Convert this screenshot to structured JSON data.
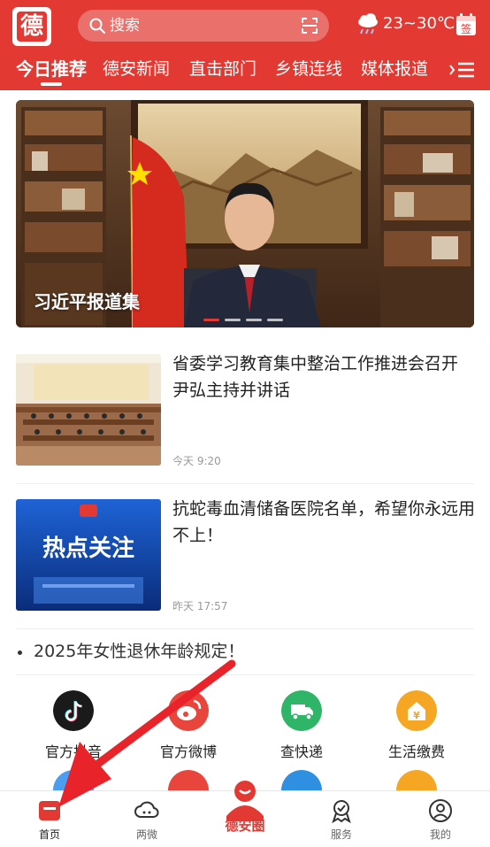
{
  "header": {
    "logo_text": "德",
    "search_placeholder": "搜索",
    "weather": "23~30℃",
    "sign_label": "签"
  },
  "tabs": [
    "今日推荐",
    "德安新闻",
    "直击部门",
    "乡镇连线",
    "媒体报道"
  ],
  "banner": {
    "caption": "习近平报道集"
  },
  "news": [
    {
      "title": "省委学习教育集中整治工作推进会召开 尹弘主持并讲话",
      "time": "今天 9:20"
    },
    {
      "title": "抗蛇毒血清储备医院名单，希望你永远用不上！",
      "time": "昨天 17:57",
      "thumb_text": "热点关注"
    }
  ],
  "ticker": "2025年女性退休年龄规定！",
  "services": [
    {
      "label": "官方抖音",
      "icon": "tiktok-icon",
      "color": "#1a1a1a"
    },
    {
      "label": "官方微博",
      "icon": "weibo-icon",
      "color": "#e8453c"
    },
    {
      "label": "查快递",
      "icon": "delivery-icon",
      "color": "#2fb567"
    },
    {
      "label": "生活缴费",
      "icon": "payment-icon",
      "color": "#f5a623"
    }
  ],
  "bottom_nav": [
    {
      "label": "首页",
      "icon": "home-icon"
    },
    {
      "label": "两微",
      "icon": "cloud-icon"
    },
    {
      "label": "德安圈",
      "icon": "dean-circle-icon"
    },
    {
      "label": "服务",
      "icon": "service-icon"
    },
    {
      "label": "我的",
      "icon": "profile-icon"
    }
  ],
  "colors": {
    "brand": "#e23a33",
    "text": "#222222",
    "muted": "#999999"
  }
}
